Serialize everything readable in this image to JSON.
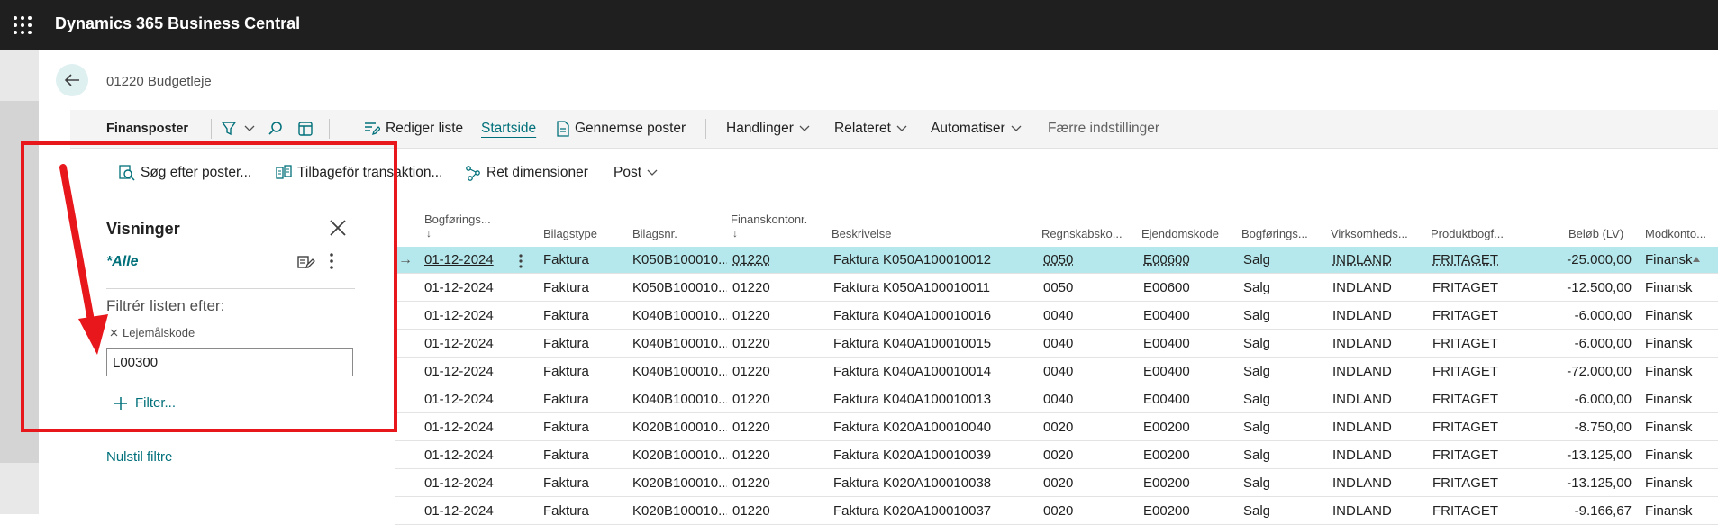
{
  "topbar": {
    "app_title": "Dynamics 365 Business Central",
    "waffle_icon": "app-launcher-icon"
  },
  "page": {
    "title": "01220 Budgetleje",
    "back_icon": "arrow-left-icon"
  },
  "actionbar": {
    "tab": "Finansposter",
    "edit_list": "Rediger liste",
    "home": "Startside",
    "review_entries": "Gennemse poster",
    "actions": "Handlinger",
    "related": "Relateret",
    "automate": "Automatiser",
    "fewer_options": "Færre indstillinger"
  },
  "subbar": {
    "find_entries": "Søg efter poster...",
    "reverse_transaction": "Tilbageför transaktion...",
    "correct_dimensions": "Ret dimensioner",
    "post": "Post"
  },
  "filterpane": {
    "views_title": "Visninger",
    "view_all": "*Alle",
    "filter_by_label": "Filtrér listen efter:",
    "filter_field_name": "Lejemålskode",
    "filter_value": "L00300",
    "add_filter": "Filter...",
    "reset_filters": "Nulstil filtre"
  },
  "grid": {
    "headers": [
      {
        "line1": "Bogførings...",
        "line2": "↓"
      },
      {
        "line1": "Bilagstype"
      },
      {
        "line1": "Bilagsnr."
      },
      {
        "line1": "Finanskontonr.",
        "line2": "↓"
      },
      {
        "line1": "Beskrivelse"
      },
      {
        "line1": "Regnskabsko..."
      },
      {
        "line1": "Ejendomskode"
      },
      {
        "line1": "Bogførings..."
      },
      {
        "line1": "Virksomheds..."
      },
      {
        "line1": "Produktbogf..."
      },
      {
        "line1": "Beløb (LV)"
      },
      {
        "line1": "Modkonto..."
      }
    ],
    "rows": [
      {
        "date": "01-12-2024",
        "doc_type": "Faktura",
        "doc_no": "K050B100010...",
        "account": "01220",
        "description": "Faktura K050A100010012",
        "dept": "0050",
        "property": "E00600",
        "gen_posting": "Salg",
        "bus_posting": "INDLAND",
        "prod_posting": "FRITAGET",
        "amount": "-25.000,00",
        "bal_account": "Finansk"
      },
      {
        "date": "01-12-2024",
        "doc_type": "Faktura",
        "doc_no": "K050B100010...",
        "account": "01220",
        "description": "Faktura K050A100010011",
        "dept": "0050",
        "property": "E00600",
        "gen_posting": "Salg",
        "bus_posting": "INDLAND",
        "prod_posting": "FRITAGET",
        "amount": "-12.500,00",
        "bal_account": "Finansk"
      },
      {
        "date": "01-12-2024",
        "doc_type": "Faktura",
        "doc_no": "K040B100010...",
        "account": "01220",
        "description": "Faktura K040A100010016",
        "dept": "0040",
        "property": "E00400",
        "gen_posting": "Salg",
        "bus_posting": "INDLAND",
        "prod_posting": "FRITAGET",
        "amount": "-6.000,00",
        "bal_account": "Finansk"
      },
      {
        "date": "01-12-2024",
        "doc_type": "Faktura",
        "doc_no": "K040B100010...",
        "account": "01220",
        "description": "Faktura K040A100010015",
        "dept": "0040",
        "property": "E00400",
        "gen_posting": "Salg",
        "bus_posting": "INDLAND",
        "prod_posting": "FRITAGET",
        "amount": "-6.000,00",
        "bal_account": "Finansk"
      },
      {
        "date": "01-12-2024",
        "doc_type": "Faktura",
        "doc_no": "K040B100010...",
        "account": "01220",
        "description": "Faktura K040A100010014",
        "dept": "0040",
        "property": "E00400",
        "gen_posting": "Salg",
        "bus_posting": "INDLAND",
        "prod_posting": "FRITAGET",
        "amount": "-72.000,00",
        "bal_account": "Finansk"
      },
      {
        "date": "01-12-2024",
        "doc_type": "Faktura",
        "doc_no": "K040B100010...",
        "account": "01220",
        "description": "Faktura K040A100010013",
        "dept": "0040",
        "property": "E00400",
        "gen_posting": "Salg",
        "bus_posting": "INDLAND",
        "prod_posting": "FRITAGET",
        "amount": "-6.000,00",
        "bal_account": "Finansk"
      },
      {
        "date": "01-12-2024",
        "doc_type": "Faktura",
        "doc_no": "K020B100010...",
        "account": "01220",
        "description": "Faktura K020A100010040",
        "dept": "0020",
        "property": "E00200",
        "gen_posting": "Salg",
        "bus_posting": "INDLAND",
        "prod_posting": "FRITAGET",
        "amount": "-8.750,00",
        "bal_account": "Finansk"
      },
      {
        "date": "01-12-2024",
        "doc_type": "Faktura",
        "doc_no": "K020B100010...",
        "account": "01220",
        "description": "Faktura K020A100010039",
        "dept": "0020",
        "property": "E00200",
        "gen_posting": "Salg",
        "bus_posting": "INDLAND",
        "prod_posting": "FRITAGET",
        "amount": "-13.125,00",
        "bal_account": "Finansk"
      },
      {
        "date": "01-12-2024",
        "doc_type": "Faktura",
        "doc_no": "K020B100010...",
        "account": "01220",
        "description": "Faktura K020A100010038",
        "dept": "0020",
        "property": "E00200",
        "gen_posting": "Salg",
        "bus_posting": "INDLAND",
        "prod_posting": "FRITAGET",
        "amount": "-13.125,00",
        "bal_account": "Finansk"
      },
      {
        "date": "01-12-2024",
        "doc_type": "Faktura",
        "doc_no": "K020B100010...",
        "account": "01220",
        "description": "Faktura K020A100010037",
        "dept": "0020",
        "property": "E00200",
        "gen_posting": "Salg",
        "bus_posting": "INDLAND",
        "prod_posting": "FRITAGET",
        "amount": "-9.166,67",
        "bal_account": "Finansk"
      }
    ]
  },
  "colors": {
    "accent": "#00707a",
    "selected_row": "#b5e8ec",
    "highlight": "#e8171c",
    "topbar": "#1f1f1f"
  }
}
